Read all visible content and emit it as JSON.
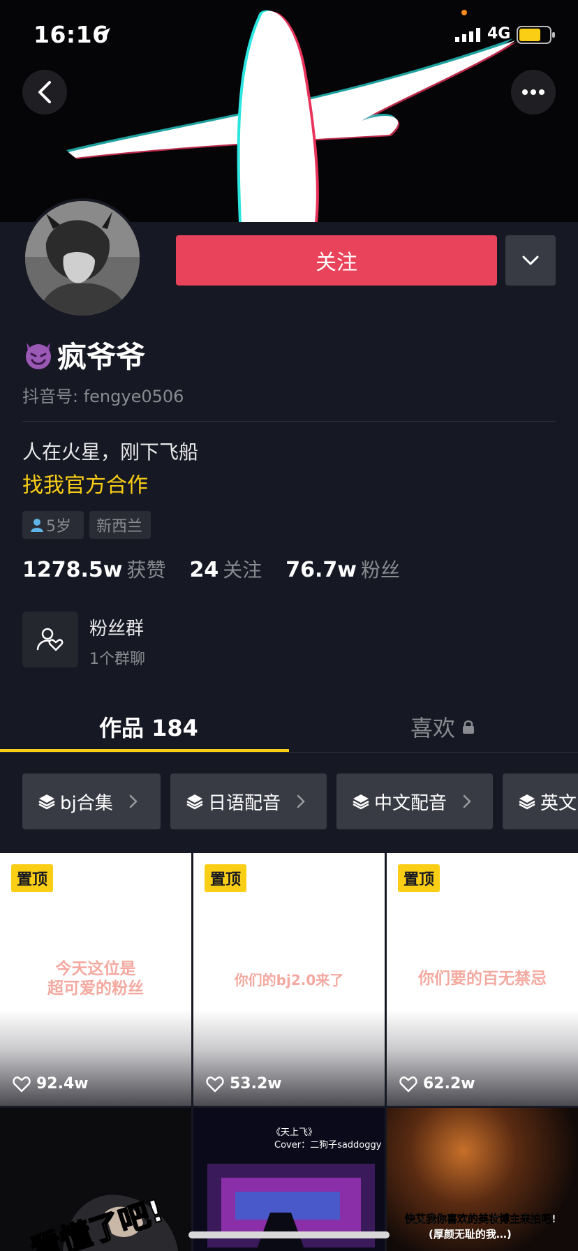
{
  "status_bar": {
    "time": "16:16",
    "network": "4G"
  },
  "profile": {
    "follow_label": "关注",
    "name": "疯爷爷",
    "douyin_id": "抖音号: fengye0506",
    "bio": "人在火星，刚下飞船",
    "bio_link": "找我官方合作",
    "tags": {
      "age": "5岁",
      "region": "新西兰"
    },
    "stats": [
      {
        "value": "1278.5w",
        "label": "获赞"
      },
      {
        "value": "24",
        "label": "关注"
      },
      {
        "value": "76.7w",
        "label": "粉丝"
      }
    ],
    "fan_group": {
      "title": "粉丝群",
      "subtitle": "1个群聊"
    }
  },
  "tabs": {
    "works": "作品 184",
    "likes": "喜欢"
  },
  "collections": [
    {
      "label": "bj合集"
    },
    {
      "label": "日语配音"
    },
    {
      "label": "中文配音"
    },
    {
      "label": "英文"
    }
  ],
  "videos": [
    {
      "pin": "置顶",
      "caption_1": "今天这位是",
      "caption_2": "超可爱的粉丝",
      "likes": "92.4w"
    },
    {
      "pin": "置顶",
      "caption_1": "你们的bj2.0来了",
      "caption_2": "",
      "likes": "53.2w"
    },
    {
      "pin": "置顶",
      "caption_1": "你们要的百无禁忌",
      "caption_2": "",
      "likes": "62.2w"
    },
    {
      "overlay": "看懂了吧!"
    },
    {
      "overlay_1": "《天上飞》",
      "overlay_2": "Cover：二狗子saddoggy"
    },
    {
      "overlay_1": "快艾我你喜欢的美妆博主来拍吧!",
      "overlay_2": "(厚颜无耻的我…)"
    }
  ],
  "colors": {
    "background": "#161823",
    "follow": "#e8435a",
    "accent": "#face15"
  }
}
